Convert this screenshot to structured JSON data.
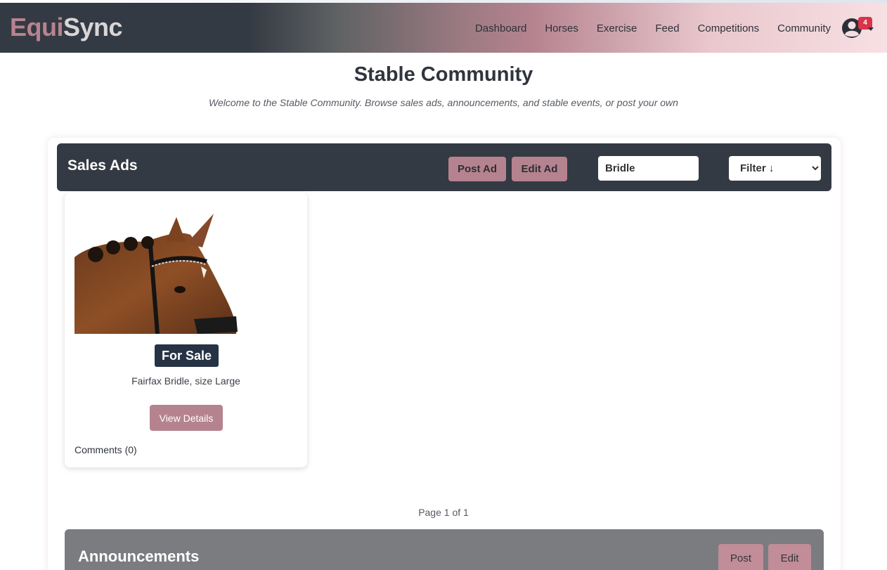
{
  "brand": {
    "part1": "Equi",
    "part2": "Sync"
  },
  "nav": {
    "links": [
      "Dashboard",
      "Horses",
      "Exercise",
      "Feed",
      "Competitions",
      "Community"
    ],
    "notification_count": "4"
  },
  "page": {
    "title": "Stable Community",
    "subtitle": "Welcome to the Stable Community. Browse sales ads, announcements, and stable events, or post your own"
  },
  "sales": {
    "title": "Sales Ads",
    "post_label": "Post Ad",
    "edit_label": "Edit Ad",
    "search_value": "Bridle",
    "filter_selected": "Filter ↓",
    "items": [
      {
        "badge": "For Sale",
        "description": "Fairfax Bridle, size Large",
        "button": "View Details",
        "comments": "Comments (0)"
      }
    ],
    "pagination": "Page 1 of 1"
  },
  "announcements": {
    "title": "Announcements",
    "post_label": "Post",
    "edit_label": "Edit"
  }
}
